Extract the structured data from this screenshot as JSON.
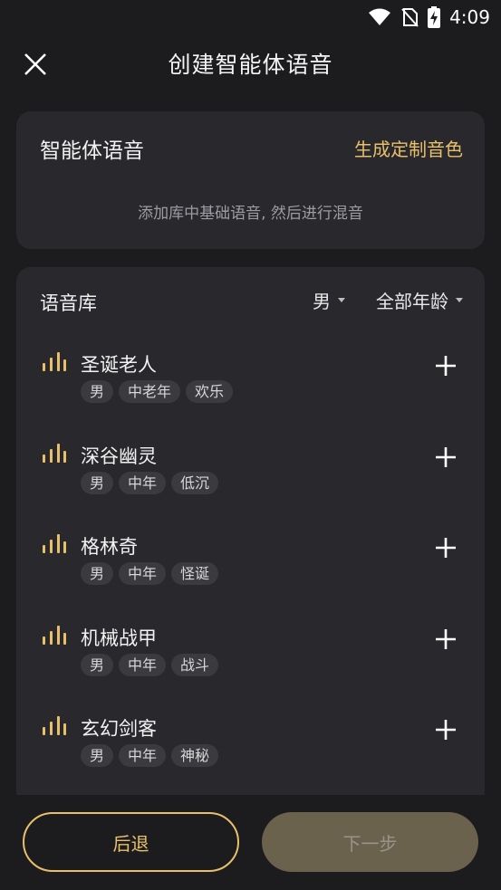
{
  "status": {
    "time": "4:09"
  },
  "header": {
    "title": "创建智能体语音"
  },
  "voice_card": {
    "title": "智能体语音",
    "custom_link": "生成定制音色",
    "hint": "添加库中基础语音, 然后进行混音"
  },
  "library": {
    "title": "语音库",
    "gender_filter": "男",
    "age_filter": "全部年龄",
    "items": [
      {
        "name": "圣诞老人",
        "tags": [
          "男",
          "中老年",
          "欢乐"
        ]
      },
      {
        "name": "深谷幽灵",
        "tags": [
          "男",
          "中年",
          "低沉"
        ]
      },
      {
        "name": "格林奇",
        "tags": [
          "男",
          "中年",
          "怪诞"
        ]
      },
      {
        "name": "机械战甲",
        "tags": [
          "男",
          "中年",
          "战斗"
        ]
      },
      {
        "name": "玄幻剑客",
        "tags": [
          "男",
          "中年",
          "神秘"
        ]
      }
    ]
  },
  "footer": {
    "back_label": "后退",
    "next_label": "下一步"
  },
  "colors": {
    "accent": "#e8c06a",
    "background": "#1c1c1f",
    "card": "#29292d"
  }
}
